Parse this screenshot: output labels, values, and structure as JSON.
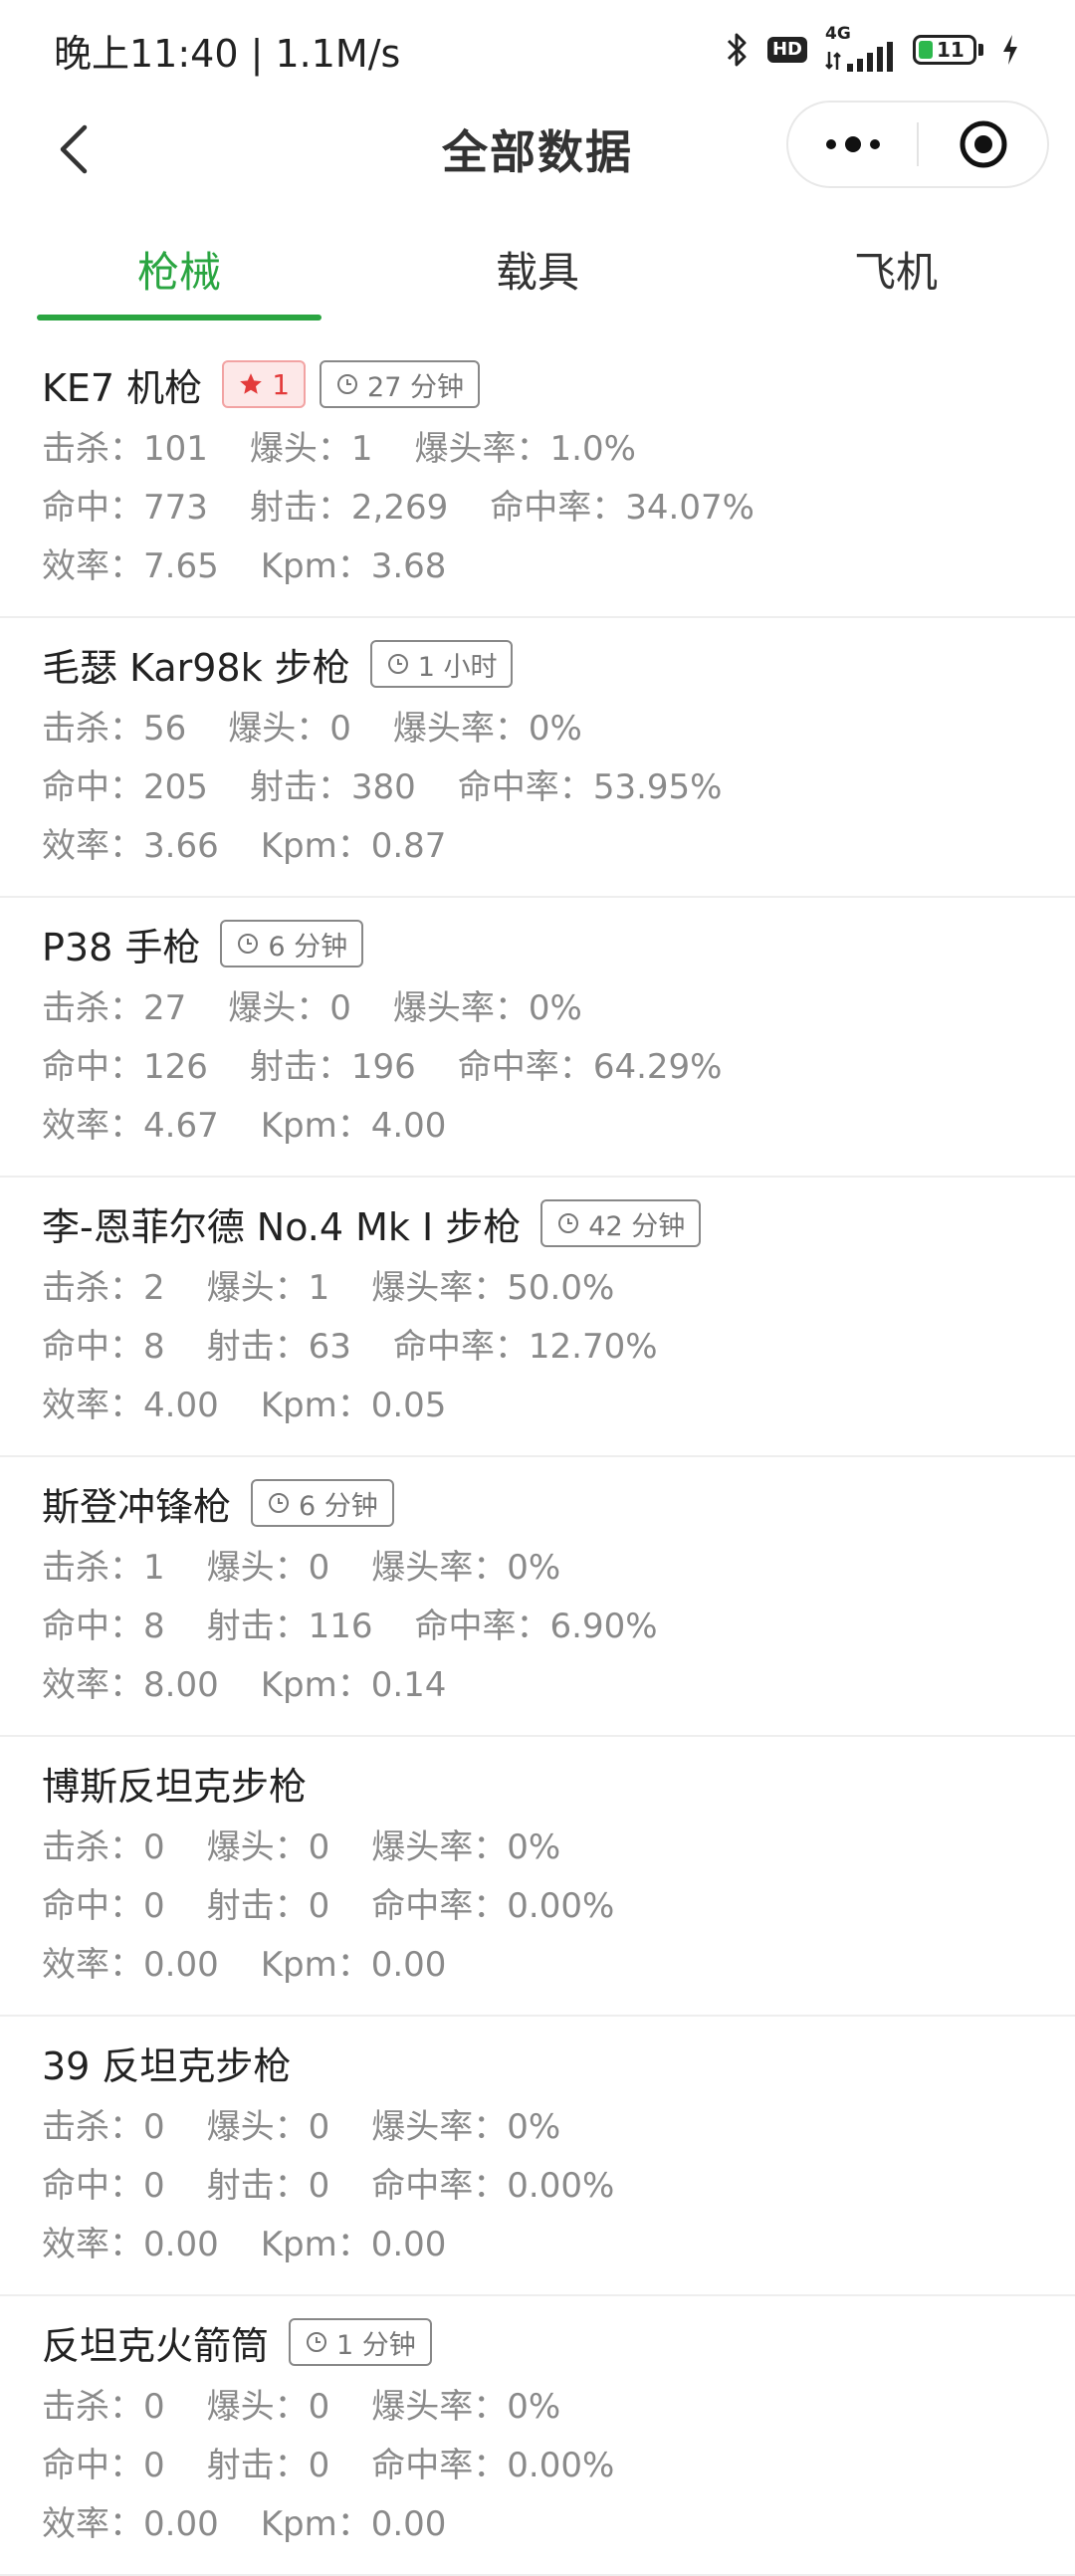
{
  "status": {
    "time": "晚上11:40 | 1.1M/s",
    "hd": "HD",
    "net": "4G",
    "battery": "11"
  },
  "nav": {
    "title": "全部数据"
  },
  "tabs": [
    "枪械",
    "载具",
    "飞机"
  ],
  "colors": {
    "accent": "#2aa541",
    "star": "#e33b3b"
  },
  "labels": {
    "kills": "击杀：",
    "headshots": "爆头：",
    "hs_rate": "爆头率：",
    "hits": "命中：",
    "shots": "射击：",
    "hit_rate": "命中率：",
    "efficiency": "效率：",
    "kpm": "Kpm："
  },
  "items": [
    {
      "name": "KE7 机枪",
      "star": "1",
      "time": "27 分钟",
      "kills": "101",
      "headshots": "1",
      "hs_rate": "1.0%",
      "hits": "773",
      "shots": "2,269",
      "hit_rate": "34.07%",
      "efficiency": "7.65",
      "kpm": "3.68"
    },
    {
      "name": "毛瑟 Kar98k 步枪",
      "time": "1 小时",
      "kills": "56",
      "headshots": "0",
      "hs_rate": "0%",
      "hits": "205",
      "shots": "380",
      "hit_rate": "53.95%",
      "efficiency": "3.66",
      "kpm": "0.87"
    },
    {
      "name": "P38 手枪",
      "time": "6 分钟",
      "kills": "27",
      "headshots": "0",
      "hs_rate": "0%",
      "hits": "126",
      "shots": "196",
      "hit_rate": "64.29%",
      "efficiency": "4.67",
      "kpm": "4.00"
    },
    {
      "name": "李-恩菲尔德 No.4 Mk I 步枪",
      "time": "42 分钟",
      "kills": "2",
      "headshots": "1",
      "hs_rate": "50.0%",
      "hits": "8",
      "shots": "63",
      "hit_rate": "12.70%",
      "efficiency": "4.00",
      "kpm": "0.05"
    },
    {
      "name": "斯登冲锋枪",
      "time": "6 分钟",
      "kills": "1",
      "headshots": "0",
      "hs_rate": "0%",
      "hits": "8",
      "shots": "116",
      "hit_rate": "6.90%",
      "efficiency": "8.00",
      "kpm": "0.14"
    },
    {
      "name": "博斯反坦克步枪",
      "kills": "0",
      "headshots": "0",
      "hs_rate": "0%",
      "hits": "0",
      "shots": "0",
      "hit_rate": "0.00%",
      "efficiency": "0.00",
      "kpm": "0.00"
    },
    {
      "name": "39 反坦克步枪",
      "kills": "0",
      "headshots": "0",
      "hs_rate": "0%",
      "hits": "0",
      "shots": "0",
      "hit_rate": "0.00%",
      "efficiency": "0.00",
      "kpm": "0.00"
    },
    {
      "name": "反坦克火箭筒",
      "time": "1 分钟",
      "kills": "0",
      "headshots": "0",
      "hs_rate": "0%",
      "hits": "0",
      "shots": "0",
      "hit_rate": "0.00%",
      "efficiency": "0.00",
      "kpm": "0.00"
    }
  ]
}
